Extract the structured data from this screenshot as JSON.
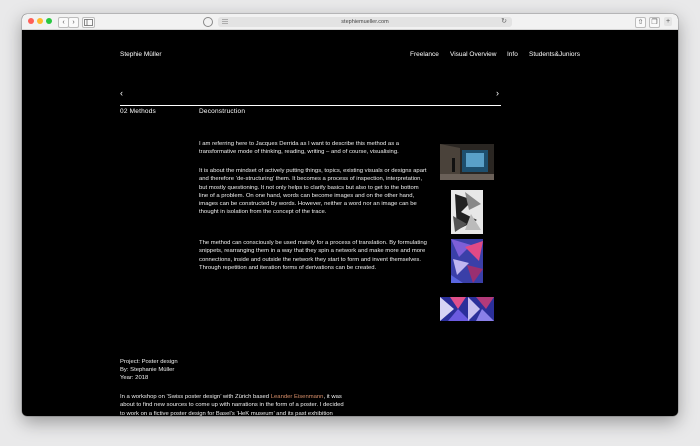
{
  "browser": {
    "url": "stephiemueller.com",
    "colors": {
      "close": "#ff5f57",
      "minimize": "#febc2e",
      "zoom": "#28c840"
    }
  },
  "header": {
    "brand": "Stephie Müller",
    "nav": [
      "Freelance",
      "Visual Overview",
      "Info",
      "Students&Juniors"
    ]
  },
  "pager": {
    "prev": "‹",
    "next": "›"
  },
  "section": {
    "number": "02 Methods",
    "title": "Deconstruction"
  },
  "body": {
    "paragraphs": [
      "I am referring here to Jacques Derrida as I want to describe this method as a transformative mode of thinking, reading, writing – and of course, visualising.",
      "It is about the mindset of actively putting things, topics, existing visuals or designs apart and therefore ‘de-structuring’ them. It becomes a process of inspection, interpretation, but mostly questioning. It not only helps to clarify basics but also to get to the bottom line of a problem. On one hand, words can become images and on the other hand, images can be constructed by words. However, neither a word nor an image can be thought in isolation from the concept of the trace.",
      "The method can consciously be used mainly for a process of translation. By formulating snippets, rearranging them in a way that they spin a network and make more and more connections, inside and outside the network they start to form and invent themselves. Through repetition and iteration forms of derivations can be created."
    ]
  },
  "project": {
    "type": "Project: Poster design",
    "by": "By: Stephanie Müller",
    "year": "Year: 2018",
    "desc_before": "In a workshop on ‘Swiss poster design’ with Zürich based ",
    "desc_link": "Leander Eisenmann",
    "desc_after": ", it was about to find new sources to come up with narrations in the form of a poster. I decided to work on a fictive poster design for Basel’s ‘HeK museum’ and its past exhibition named ‘the unframed world’."
  }
}
